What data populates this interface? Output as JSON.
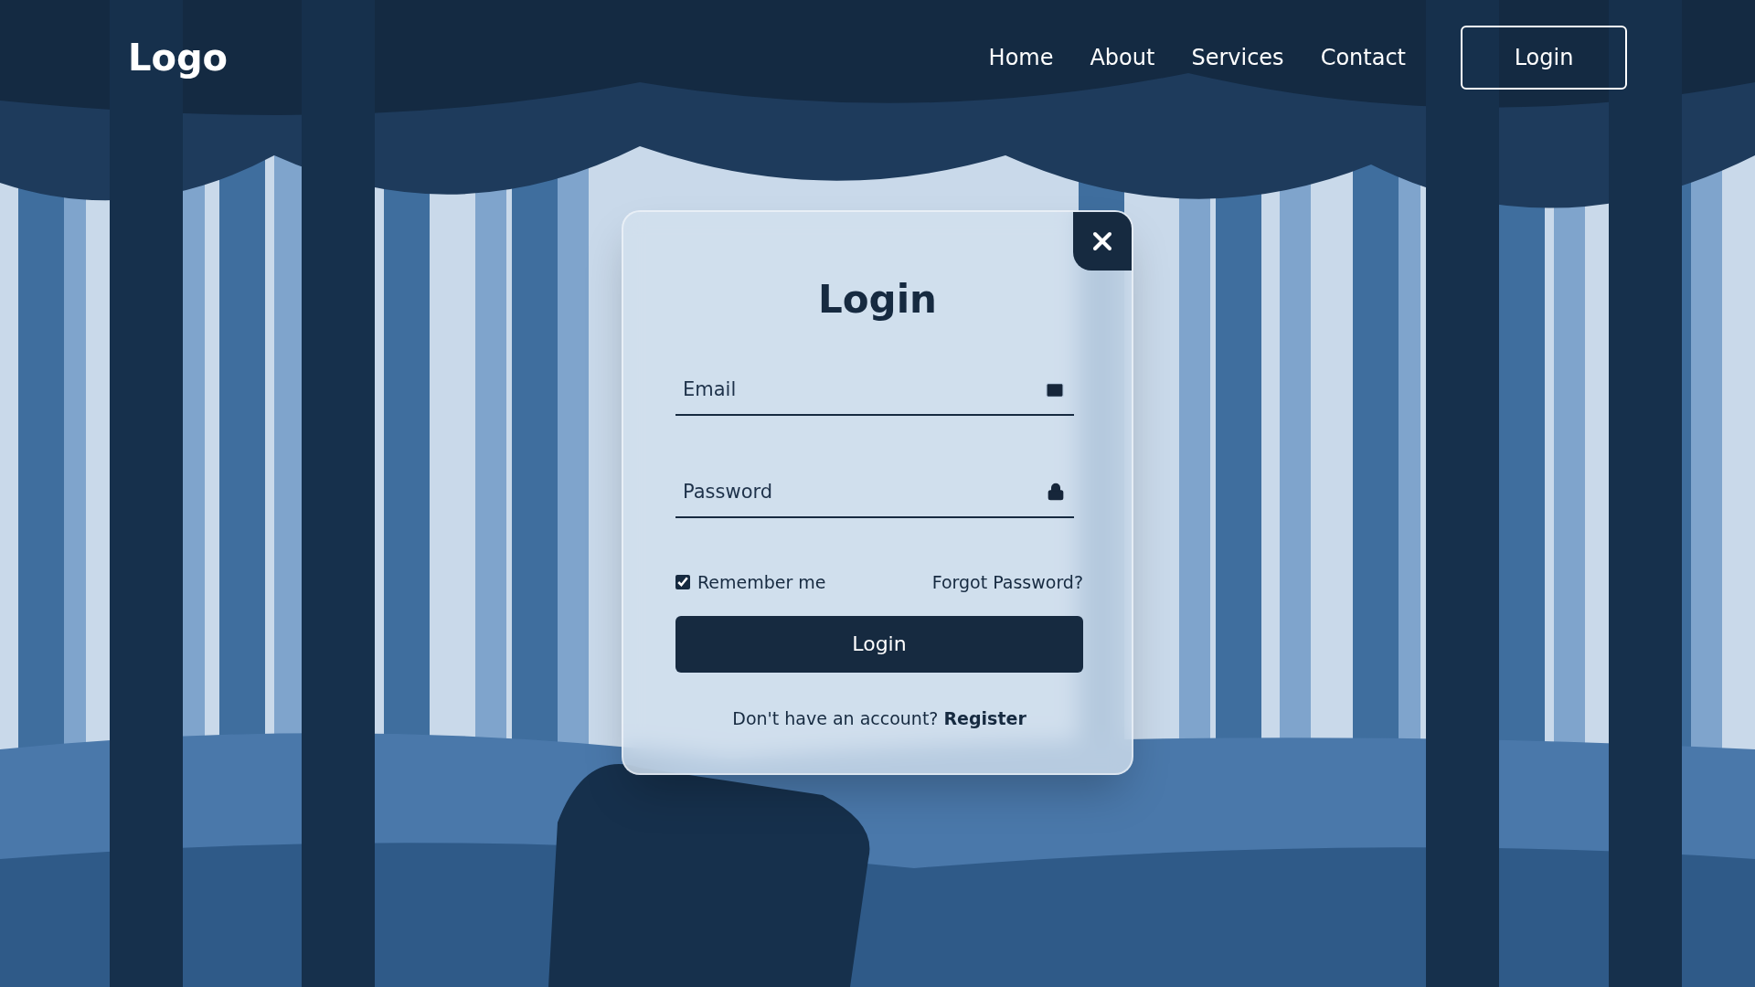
{
  "nav": {
    "logo": "Logo",
    "links": [
      {
        "label": "Home"
      },
      {
        "label": "About"
      },
      {
        "label": "Services"
      },
      {
        "label": "Contact"
      }
    ],
    "login_button": "Login"
  },
  "modal": {
    "title": "Login",
    "fields": [
      {
        "kind": "email",
        "placeholder": "Email"
      },
      {
        "kind": "password",
        "placeholder": "Password"
      }
    ],
    "remember": {
      "label": "Remember me",
      "checked": true
    },
    "forgot": "Forgot Password?",
    "submit": "Login",
    "register_prompt": "Don't have an account?",
    "register_link": "Register"
  }
}
